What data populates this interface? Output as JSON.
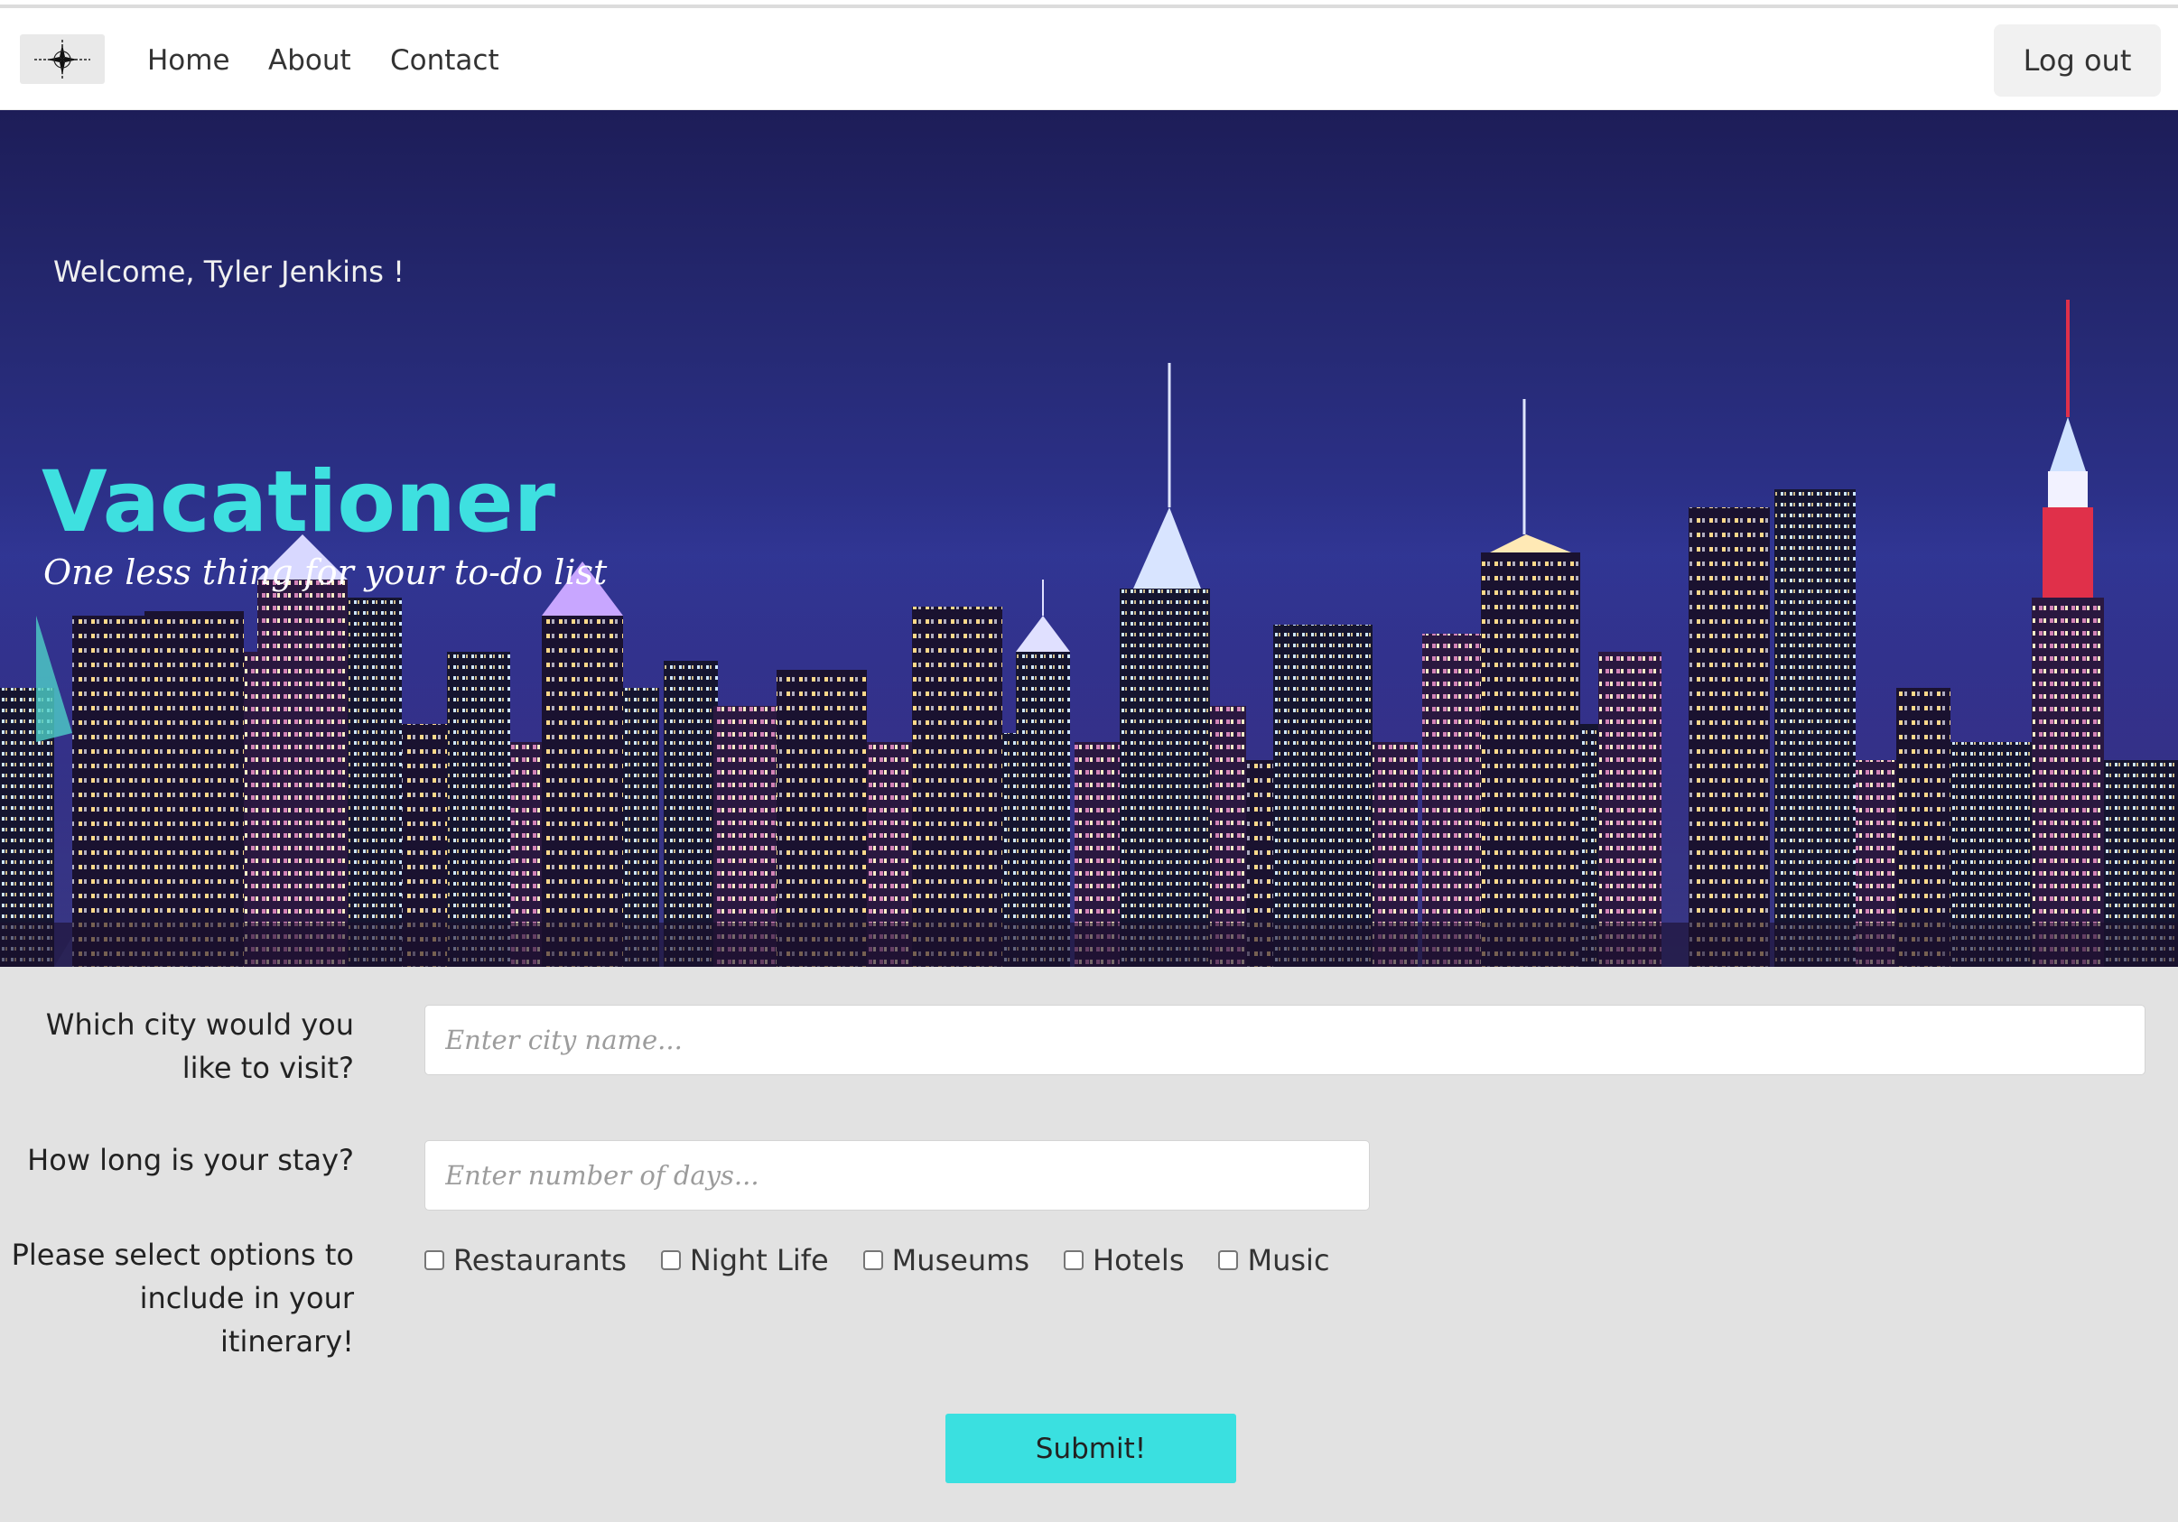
{
  "nav": {
    "logo_icon": "compass-rose-icon",
    "links": [
      "Home",
      "About",
      "Contact"
    ],
    "logout_label": "Log out"
  },
  "hero": {
    "welcome": "Welcome, Tyler Jenkins !",
    "title": "Vacationer",
    "tagline": "One less thing for your to-do list",
    "title_color": "#3ee0e0"
  },
  "form": {
    "city_label": "Which city would you like to visit?",
    "city_placeholder": "Enter city name...",
    "city_value": "",
    "stay_label": "How long is your stay?",
    "stay_placeholder": "Enter number of days...",
    "stay_value": "",
    "options_label": "Please select options to include in your itinerary!",
    "options": [
      {
        "label": "Restaurants",
        "checked": false
      },
      {
        "label": "Night Life",
        "checked": false
      },
      {
        "label": "Museums",
        "checked": false
      },
      {
        "label": "Hotels",
        "checked": false
      },
      {
        "label": "Music",
        "checked": false
      }
    ],
    "submit_label": "Submit!",
    "accent_color": "#3ae0e0",
    "background_color": "#e2e2e2"
  }
}
